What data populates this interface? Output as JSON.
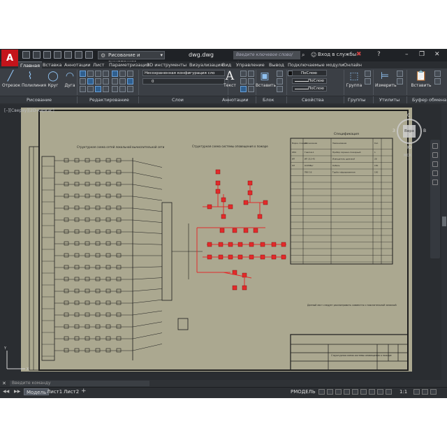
{
  "app": {
    "logo_letter": "A",
    "window_title": "dwg.dwg",
    "workspace": "Рисование и аннотации",
    "search_placeholder": "Введите ключевое слово/фразу",
    "signin": "Вход в службы",
    "window_buttons": [
      "–",
      "❐",
      "✕"
    ]
  },
  "ribbon_tabs": [
    {
      "label": "Главная",
      "active": true
    },
    {
      "label": "Вставка"
    },
    {
      "label": "Аннотации"
    },
    {
      "label": "Лист"
    },
    {
      "label": "Параметризация"
    },
    {
      "label": "3D инструменты"
    },
    {
      "label": "Визуализация"
    },
    {
      "label": "Вид"
    },
    {
      "label": "Управление"
    },
    {
      "label": "Вывод"
    },
    {
      "label": "Подключаемые модули"
    },
    {
      "label": "Онлайн"
    }
  ],
  "ribbon": {
    "draw_tools": [
      "Отрезок",
      "Полилиния",
      "Круг",
      "Дуга"
    ],
    "text_tool": "Текст",
    "insert_tool": "Вставить",
    "group_tool": "Группа",
    "measure_tool": "Измерить",
    "paste_tool": "Вставить",
    "layer_combo": "Несохраненная конфигурация сло",
    "layer_combo2": "0",
    "prop_combo": "ПоСлою",
    "lineprops": [
      "ПоСлою",
      "ПоСлою"
    ],
    "panels": [
      "Рисование",
      "Редактирование",
      "Слои",
      "Аннотации",
      "Блок",
      "Свойства",
      "Группы",
      "Утилиты",
      "Буфер обмена"
    ]
  },
  "viewport": {
    "label": "[–][Сверху][2D-каркас]",
    "viewcube_face": "Верх",
    "compass": [
      "С",
      "В",
      "Ю",
      "З"
    ],
    "wcs": "МСК"
  },
  "drawing": {
    "title_left": "Структурная схема сетей локальной вычислительной сети",
    "title_right": "Структурная схема системы оповещения о пожаре",
    "spec_title": "Спецификация",
    "spec_headers": [
      "Марка, позиция",
      "Обозначение",
      "Наименование",
      "Кол."
    ],
    "spec_rows": [
      [
        "КМ1",
        "Гиалом-1",
        "Прибор охранно-пожарный",
        "1"
      ],
      [
        "ИП",
        "ИП 212-45",
        "Извещатель дымовой",
        "28"
      ],
      [
        "КЛ",
        "КСРЭВнг",
        "Кабель",
        "150"
      ],
      [
        "",
        "ПВХ 16",
        "Труба гофрированная",
        "150"
      ]
    ],
    "note": "Данный лист следует рассматривать совместно с пояснительной запиской",
    "stamp": "Структурная схема системы оповещения о пожаре"
  },
  "cmd": {
    "prompt": "Введите команду"
  },
  "layout_tabs": [
    {
      "label": "Модель",
      "active": true
    },
    {
      "label": "Лист1"
    },
    {
      "label": "Лист2"
    }
  ],
  "status": {
    "model": "РМОДЕЛЬ",
    "scale": "1:1"
  },
  "colors": {
    "paper": "#aba890",
    "red": "#e22b2b",
    "line": "#1c1c1c"
  }
}
